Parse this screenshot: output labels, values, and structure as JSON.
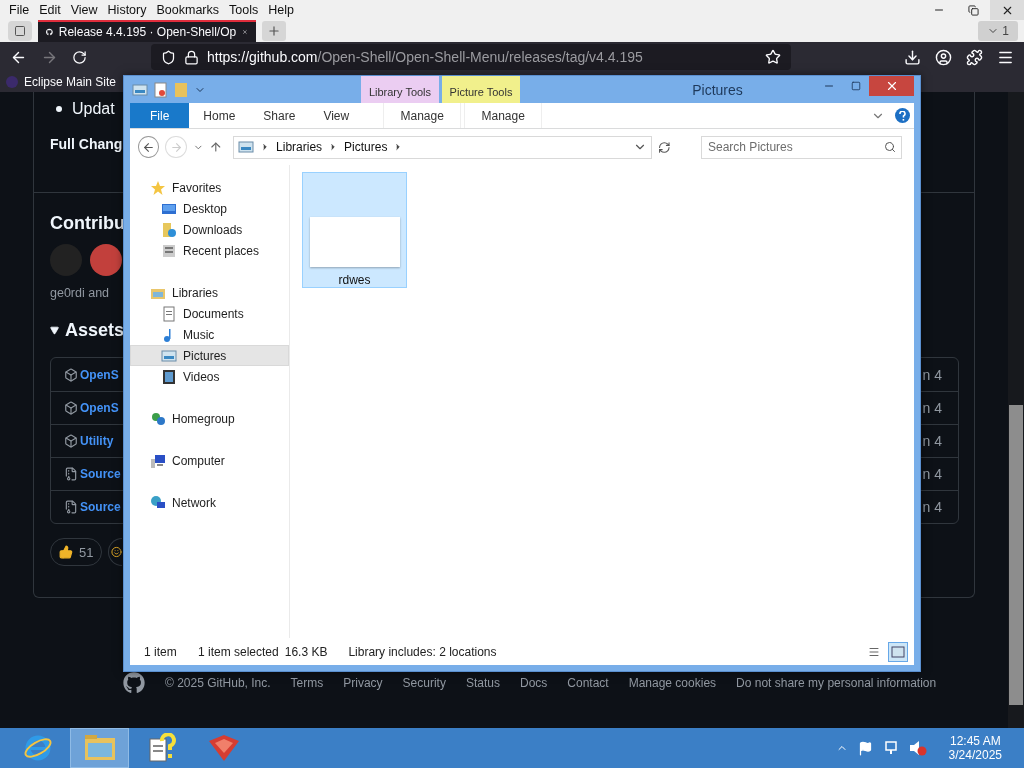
{
  "browser": {
    "menu": [
      "File",
      "Edit",
      "View",
      "History",
      "Bookmarks",
      "Tools",
      "Help"
    ],
    "tabs": [
      {
        "title": "Release 4.4.195 · Open-Shell/Op",
        "selected": true
      }
    ],
    "tab_count": "1",
    "url": {
      "domain": "https://github.com",
      "path": "/Open-Shell/Open-Shell-Menu/releases/tag/v4.4.195"
    },
    "bookmarks": [
      "Eclipse Main Site"
    ]
  },
  "page": {
    "bullet": "Updat",
    "full_changelog": "Full Chang",
    "contributors_heading": "Contribu",
    "contributors_text": "ge0rdi and",
    "assets_heading": "Assets",
    "assets": [
      {
        "kind": "package",
        "name": "OpenS",
        "date": "n 4"
      },
      {
        "kind": "package",
        "name": "OpenS",
        "date": "n 4"
      },
      {
        "kind": "package",
        "name": "Utility",
        "date": "n 4"
      },
      {
        "kind": "archive",
        "name": "Source",
        "date": "n 4"
      },
      {
        "kind": "archive",
        "name": "Source",
        "date": "n 4"
      }
    ],
    "reactions": [
      {
        "kind": "thumbs",
        "count": "51"
      },
      {
        "kind": "smile"
      }
    ],
    "footer": [
      "© 2025 GitHub, Inc.",
      "Terms",
      "Privacy",
      "Security",
      "Status",
      "Docs",
      "Contact",
      "Manage cookies",
      "Do not share my personal information"
    ]
  },
  "explorer": {
    "title": "Pictures",
    "context_tabs": [
      {
        "label": "Library Tools",
        "tab": "Manage",
        "color": "#ebcdf2"
      },
      {
        "label": "Picture Tools",
        "tab": "Manage",
        "color": "#f1f08c"
      }
    ],
    "ribbon_tabs": [
      {
        "label": "File",
        "kind": "file"
      },
      {
        "label": "Home",
        "kind": "tab"
      },
      {
        "label": "Share",
        "kind": "tab"
      },
      {
        "label": "View",
        "kind": "tab"
      }
    ],
    "breadcrumbs": [
      "Libraries",
      "Pictures"
    ],
    "search": {
      "placeholder": "Search Pictures"
    },
    "nav": [
      {
        "label": "Favorites",
        "kind": "star",
        "selected": false,
        "children": [
          {
            "label": "Desktop",
            "kind": "desktop",
            "selected": false
          },
          {
            "label": "Downloads",
            "kind": "downloads",
            "selected": false
          },
          {
            "label": "Recent places",
            "kind": "recent",
            "selected": false
          }
        ]
      },
      {
        "label": "Libraries",
        "kind": "libraries",
        "selected": false,
        "children": [
          {
            "label": "Documents",
            "kind": "documents",
            "selected": false
          },
          {
            "label": "Music",
            "kind": "music",
            "selected": false
          },
          {
            "label": "Pictures",
            "kind": "pictures",
            "selected": true
          },
          {
            "label": "Videos",
            "kind": "videos",
            "selected": false
          }
        ]
      },
      {
        "label": "Homegroup",
        "kind": "homegroup",
        "selected": false
      },
      {
        "label": "Computer",
        "kind": "computer",
        "selected": false
      },
      {
        "label": "Network",
        "kind": "network",
        "selected": false
      }
    ],
    "files": [
      {
        "name": "rdwes",
        "selected": true
      }
    ],
    "status": {
      "count": "1 item",
      "selection": "1 item selected",
      "size": "16.3 KB",
      "library": "Library includes: 2 locations"
    },
    "views": [
      {
        "kind": "details",
        "selected": false
      },
      {
        "kind": "thumbnails",
        "selected": true
      }
    ]
  },
  "taskbar": {
    "apps": [
      {
        "kind": "ie",
        "selected": false
      },
      {
        "kind": "explorer",
        "selected": true
      },
      {
        "kind": "help",
        "selected": false
      },
      {
        "kind": "app",
        "selected": false
      }
    ],
    "time": "12:45 AM",
    "date": "3/24/2025"
  }
}
